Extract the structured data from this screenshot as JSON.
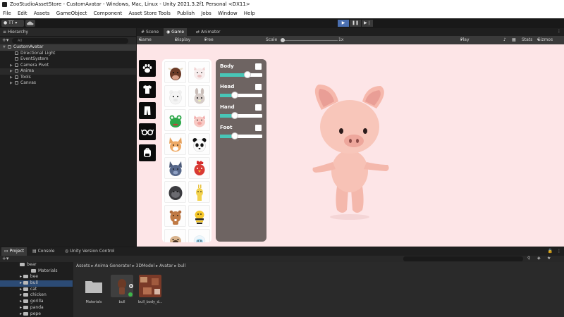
{
  "window": {
    "title": "ZooStudioAssetStore - CustomAvatar - Windows, Mac, Linux - Unity 2021.3.2f1 Personal <DX11>"
  },
  "menu": [
    "File",
    "Edit",
    "Assets",
    "GameObject",
    "Component",
    "Asset Store Tools",
    "Publish",
    "Jobs",
    "Window",
    "Help"
  ],
  "toolbar": {
    "account_label": "TT"
  },
  "hierarchy": {
    "tab_label": "Hierarchy",
    "search_placeholder": "All",
    "root": "CustomAvatar",
    "items": [
      "Directional Light",
      "EventSystem",
      "Camera Pivot",
      "Anima",
      "Tools",
      "Canvas"
    ]
  },
  "game_tabs": [
    "Scene",
    "Game",
    "Animator"
  ],
  "game_bar": {
    "mode": "Game",
    "display": "Display 1",
    "aspect": "Free Aspect",
    "scale_label": "Scale",
    "scale_value": "1x",
    "play_mode": "Play Focused",
    "stats": "Stats",
    "gizmos": "Gizmos"
  },
  "customizer": {
    "categories": [
      "paw-icon",
      "shirt-icon",
      "pants-icon",
      "glasses-icon",
      "backpack-icon"
    ],
    "properties": [
      {
        "label": "Body",
        "value": 0.65
      },
      {
        "label": "Head",
        "value": 0.35
      },
      {
        "label": "Hand",
        "value": 0.35
      },
      {
        "label": "Foot",
        "value": 0.35
      }
    ],
    "avatars": [
      "bull",
      "pig-white",
      "bear",
      "rabbit",
      "frog",
      "pig",
      "fox",
      "panda",
      "wolf",
      "rooster",
      "gorilla",
      "giraffe",
      "beaver",
      "bee",
      "pug",
      "yeti"
    ]
  },
  "project": {
    "tabs": [
      "Project",
      "Console",
      "Unity Version Control"
    ],
    "tree": [
      "bear",
      "Materials",
      "bee",
      "bull",
      "cat",
      "chicken",
      "gorilla",
      "panda",
      "pepe"
    ],
    "breadcrumb": [
      "Assets",
      "Anima Generator",
      "3DModel",
      "Avatar",
      "bull"
    ],
    "assets": [
      "Materials",
      "bull",
      "bull_body_d..."
    ]
  }
}
